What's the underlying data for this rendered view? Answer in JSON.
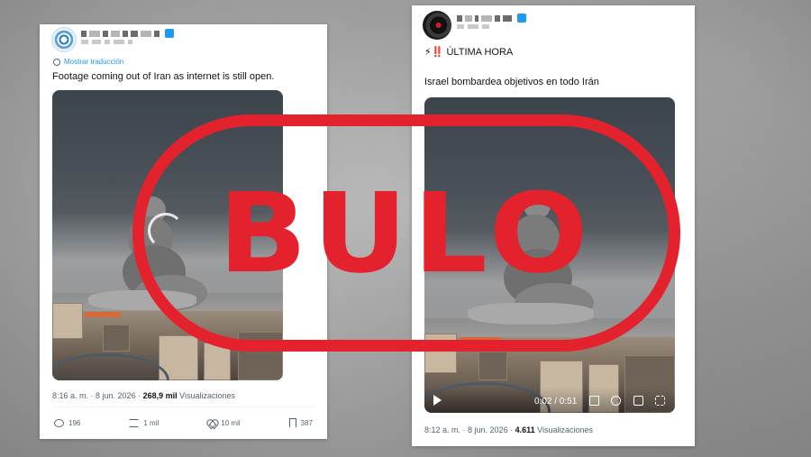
{
  "left_tweet": {
    "translate_label": "Mostrar traducción",
    "text": "Footage coming out of Iran as internet is still open.",
    "time": "8:16 a. m.",
    "date": "8 jun. 2026",
    "views_count": "268,9 mil",
    "views_label": "Visualizaciones",
    "replies": "196",
    "retweets": "1 mil",
    "likes": "10 mil",
    "bookmarks": "387"
  },
  "right_tweet": {
    "emoji_line": "⚡‼️",
    "headline": "ÚLTIMA HORA",
    "text": "Israel bombardea objetivos en todo Irán",
    "video_time": "0:02 / 0:51",
    "time": "8:12 a. m.",
    "date": "8 jun. 2026",
    "views_count": "4.611",
    "views_label": "Visualizaciones"
  },
  "stamp": {
    "text": "BULO",
    "color": "#e3222e"
  },
  "colors": {
    "link_blue": "#1d9bf0",
    "meta_gray": "#536471"
  }
}
